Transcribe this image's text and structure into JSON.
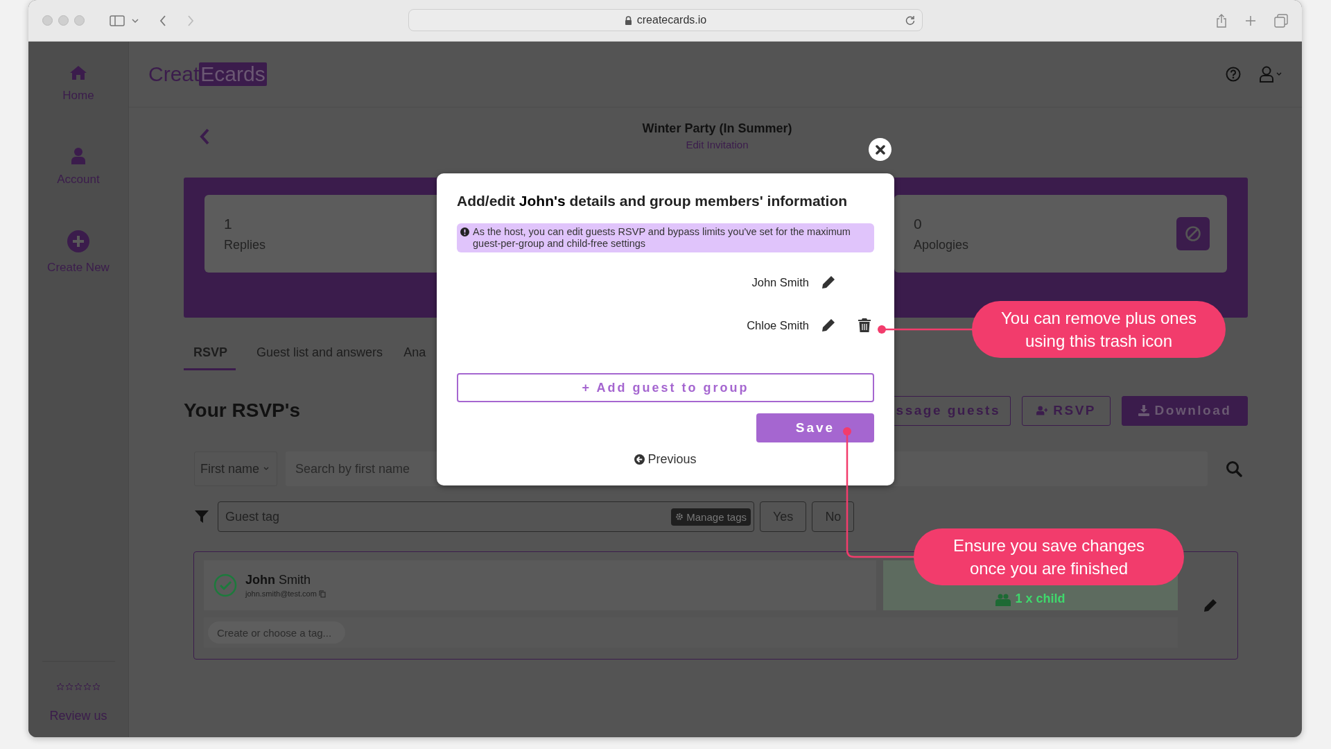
{
  "browser": {
    "url": "createcards.io"
  },
  "sidebar": {
    "items": [
      {
        "kind": "home",
        "label": "Home"
      },
      {
        "kind": "account",
        "label": "Account"
      },
      {
        "kind": "create",
        "label": "Create New"
      }
    ],
    "review": {
      "stars": 0,
      "label": "Review us"
    }
  },
  "header": {
    "logo_plain": "Creat",
    "logo_highlight": "Ecards"
  },
  "event": {
    "title": "Winter Party (In Summer)",
    "link": "Edit Invitation"
  },
  "stats": [
    {
      "value": "1",
      "label": "Replies",
      "kind": "plain"
    },
    {
      "value": "0",
      "label": "Apologies",
      "kind": "declined"
    }
  ],
  "tabs": [
    {
      "label": "RSVP",
      "selected": true
    },
    {
      "label": "Guest list and answers",
      "selected": false
    },
    {
      "label": "Ana",
      "selected": false
    }
  ],
  "heading": "Your RSVP's",
  "actions": [
    {
      "label": "ssage guests",
      "kind": "outline"
    },
    {
      "label": "RSVP",
      "kind": "add-person"
    },
    {
      "label": "Download",
      "kind": "download"
    }
  ],
  "search": {
    "field": "First name",
    "placeholder": "Search by first name"
  },
  "filter": {
    "placeholder": "Guest tag",
    "manage": "Manage tags",
    "buttons": [
      "Yes",
      "No"
    ]
  },
  "guests": [
    {
      "first": "John",
      "last": "Smith",
      "email": "john.smith@test.com",
      "attending": true,
      "note": "1 x child",
      "tag_placeholder": "Create or choose a tag..."
    }
  ],
  "modal": {
    "title": "Add/edit **John's** details and group members' information",
    "info": "As the host, you can edit guests RSVP and bypass limits you've set for the maximum guest-per-group and child-free settings",
    "members": [
      {
        "name": "John Smith",
        "removable": false
      },
      {
        "name": "Chloe Smith",
        "removable": true
      }
    ],
    "add": "+ Add guest to group",
    "save": "Save",
    "previous": "Previous"
  },
  "callouts": [
    {
      "text": "You can remove plus ones using this trash icon"
    },
    {
      "text": "Ensure you save changes once you are finished"
    }
  ]
}
